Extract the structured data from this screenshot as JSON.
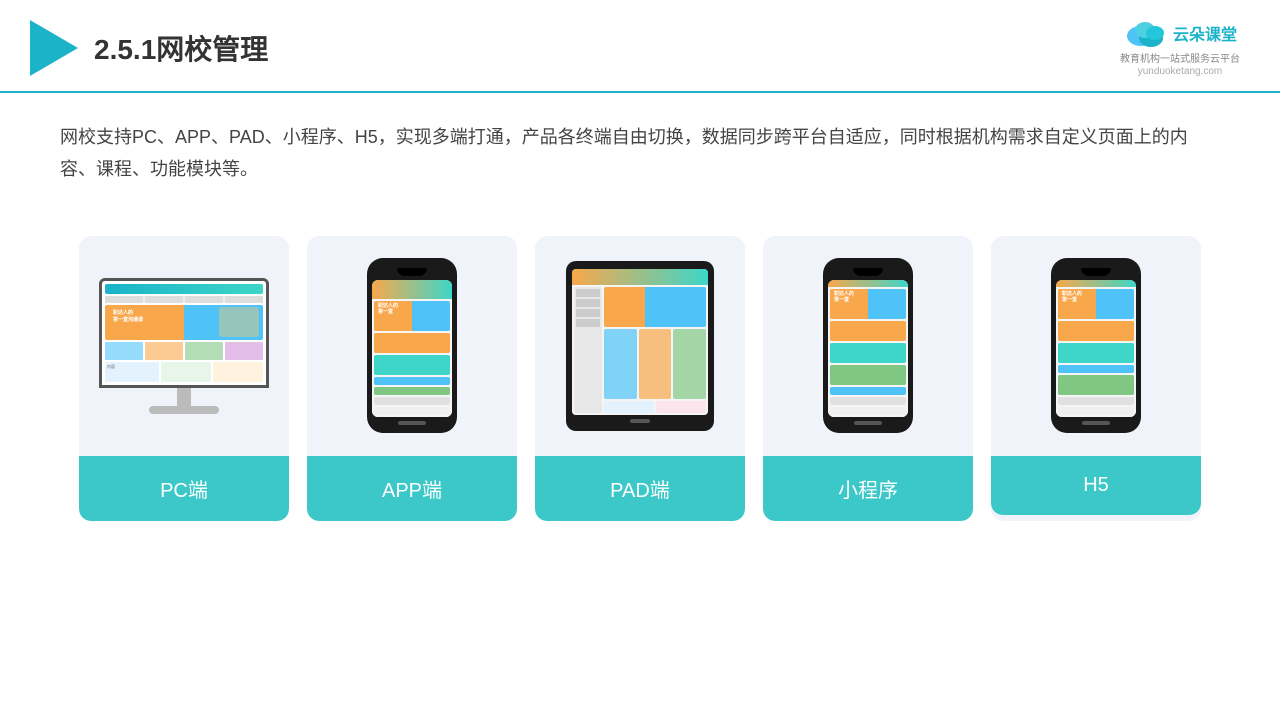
{
  "header": {
    "title": "2.5.1网校管理",
    "brand": {
      "name": "云朵课堂",
      "slogan": "教育机构一站\n式服务云平台",
      "url": "yunduoketang.com"
    }
  },
  "description": {
    "text": "网校支持PC、APP、PAD、小程序、H5，实现多端打通，产品各终端自由切换，数据同步跨平台自适应，同时根据机构需求自定义页面上的内容、课程、功能模块等。"
  },
  "cards": [
    {
      "id": "pc",
      "label": "PC端",
      "type": "pc"
    },
    {
      "id": "app",
      "label": "APP端",
      "type": "phone"
    },
    {
      "id": "pad",
      "label": "PAD端",
      "type": "tablet"
    },
    {
      "id": "miniprogram",
      "label": "小程序",
      "type": "phone"
    },
    {
      "id": "h5",
      "label": "H5",
      "type": "phone"
    }
  ],
  "colors": {
    "teal": "#3cc8c8",
    "header_line": "#1ab3c8",
    "bg_card": "#f0f4fa"
  }
}
